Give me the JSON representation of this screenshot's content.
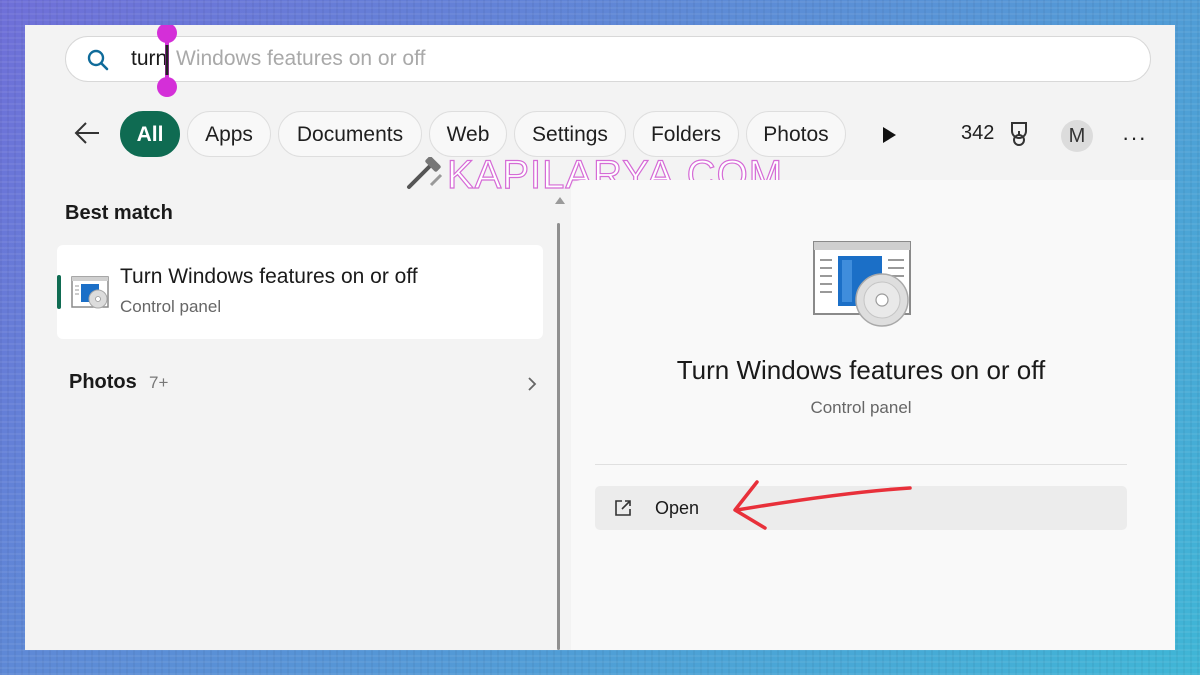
{
  "search": {
    "typed": "turn",
    "suggestion": "Windows features on or off"
  },
  "filters": {
    "chips": [
      {
        "label": "All",
        "active": true
      },
      {
        "label": "Apps"
      },
      {
        "label": "Documents"
      },
      {
        "label": "Web"
      },
      {
        "label": "Settings"
      },
      {
        "label": "Folders"
      },
      {
        "label": "Photos"
      }
    ],
    "points": "342",
    "avatar_initial": "M",
    "more": "···"
  },
  "watermark": "KAPILARYA.COM",
  "results": {
    "section_title": "Best match",
    "best_match": {
      "title": "Turn Windows features on or off",
      "subtitle": "Control panel"
    },
    "photos": {
      "label": "Photos",
      "count": "7+"
    }
  },
  "preview": {
    "title": "Turn Windows features on or off",
    "subtitle": "Control panel",
    "action_label": "Open"
  },
  "colors": {
    "accent": "#0f6b52",
    "annotation_arrow": "#e8303a",
    "cursor_marker": "#d42fd8"
  }
}
